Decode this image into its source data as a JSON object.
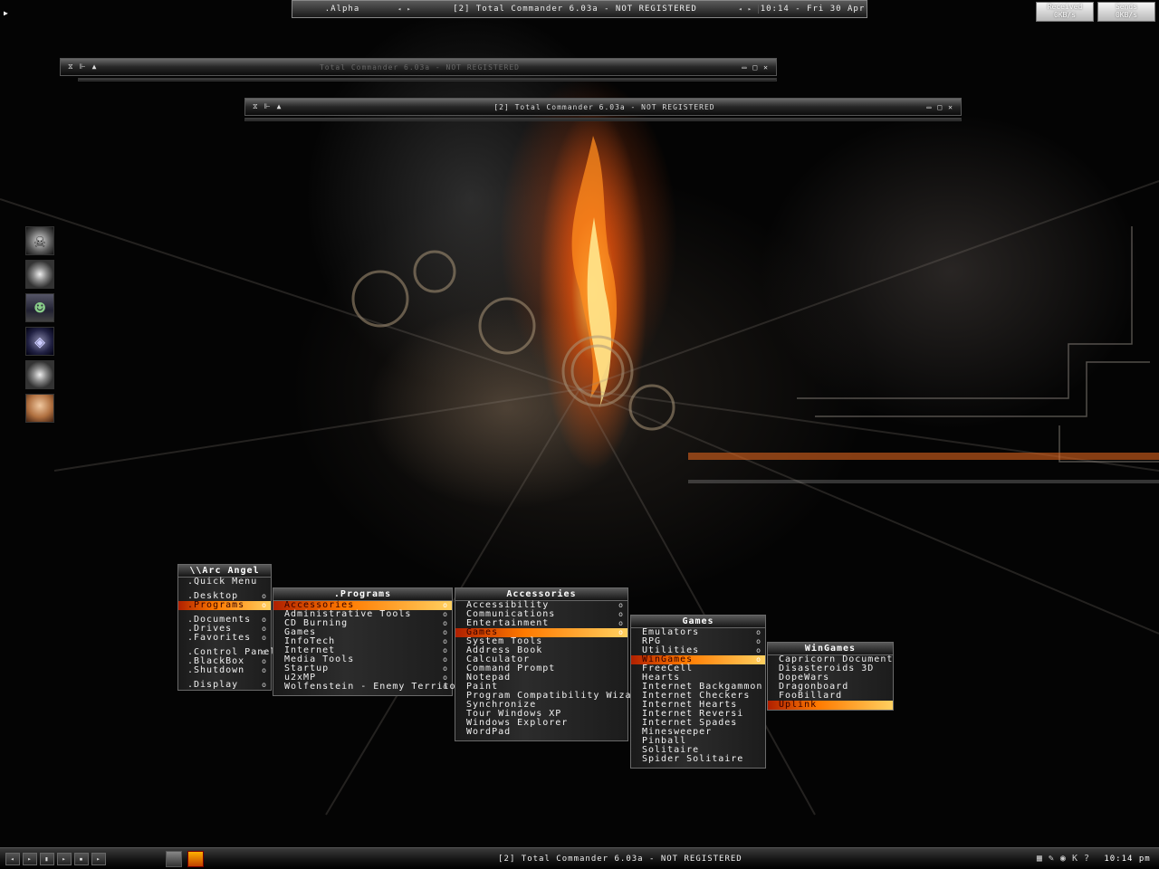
{
  "topbar": {
    "workspace": ".Alpha",
    "window_title": "[2] Total Commander 6.03a - NOT REGISTERED",
    "clock": "10:14 - Fri 30 Apr"
  },
  "network": {
    "received_label": "Received",
    "received_value": "0KB/s",
    "sends_label": "Sends",
    "sends_value": "0KB/s"
  },
  "windows": [
    {
      "title": "Total Commander 6.03a - NOT REGISTERED"
    },
    {
      "title": "[2] Total Commander 6.03a - NOT REGISTERED"
    }
  ],
  "root_menu": {
    "title": "\\\\Arc Angel",
    "items": [
      {
        "label": ".Quick Menu"
      },
      {
        "label": ".Desktop"
      },
      {
        "label": ".Programs"
      },
      {
        "label": ".Documents"
      },
      {
        "label": ".Drives"
      },
      {
        "label": ".Favorites"
      },
      {
        "label": ".Control Panel"
      },
      {
        "label": ".BlackBox"
      },
      {
        "label": ".Shutdown"
      },
      {
        "label": ".Display"
      }
    ]
  },
  "programs_menu": {
    "title": ".Programs",
    "items": [
      {
        "label": "Accessories"
      },
      {
        "label": "Administrative Tools"
      },
      {
        "label": "CD Burning"
      },
      {
        "label": "Games"
      },
      {
        "label": "InfoTech"
      },
      {
        "label": "Internet"
      },
      {
        "label": "Media Tools"
      },
      {
        "label": "Startup"
      },
      {
        "label": "u2xMP"
      },
      {
        "label": "Wolfenstein - Enemy Territory"
      }
    ]
  },
  "accessories_menu": {
    "title": "Accessories",
    "items": [
      {
        "label": "Accessibility"
      },
      {
        "label": "Communications"
      },
      {
        "label": "Entertainment"
      },
      {
        "label": "Games"
      },
      {
        "label": "System Tools"
      },
      {
        "label": "Address Book"
      },
      {
        "label": "Calculator"
      },
      {
        "label": "Command Prompt"
      },
      {
        "label": "Notepad"
      },
      {
        "label": "Paint"
      },
      {
        "label": "Program Compatibility Wizard"
      },
      {
        "label": "Synchronize"
      },
      {
        "label": "Tour Windows XP"
      },
      {
        "label": "Windows Explorer"
      },
      {
        "label": "WordPad"
      }
    ]
  },
  "games_menu": {
    "title": "Games",
    "items": [
      {
        "label": "Emulators"
      },
      {
        "label": "RPG"
      },
      {
        "label": "Utilities"
      },
      {
        "label": "WinGames"
      },
      {
        "label": "FreeCell"
      },
      {
        "label": "Hearts"
      },
      {
        "label": "Internet Backgammon"
      },
      {
        "label": "Internet Checkers"
      },
      {
        "label": "Internet Hearts"
      },
      {
        "label": "Internet Reversi"
      },
      {
        "label": "Internet Spades"
      },
      {
        "label": "Minesweeper"
      },
      {
        "label": "Pinball"
      },
      {
        "label": "Solitaire"
      },
      {
        "label": "Spider Solitaire"
      }
    ]
  },
  "wingames_menu": {
    "title": "WinGames",
    "items": [
      {
        "label": "Capricorn Document"
      },
      {
        "label": "Disasteroids 3D"
      },
      {
        "label": "DopeWars"
      },
      {
        "label": "Dragonboard"
      },
      {
        "label": "FooBillard"
      },
      {
        "label": "Uplink"
      }
    ]
  },
  "submenu_marker": "o",
  "taskbar": {
    "window_title": "[2] Total Commander 6.03a - NOT REGISTERED",
    "clock": "10:14 pm",
    "help": "?"
  }
}
